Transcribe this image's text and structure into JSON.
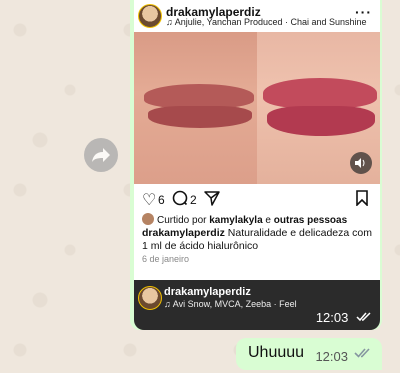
{
  "post": {
    "username": "drakamylaperdiz",
    "music": "Anjulie, Yanchan Produced · Chai and Sunshine",
    "likes": "6",
    "comments": "2",
    "liked_prefix": "Curtido por",
    "liked_user": "kamylakyla",
    "liked_and": "e",
    "liked_others": "outras pessoas",
    "caption_user": "drakamylaperdiz",
    "caption_text": "Naturalidade e delicadeza com 1 ml de ácido hialurônico",
    "date": "6 de janeiro"
  },
  "reel": {
    "username": "drakamylaperdiz",
    "music": "Avi Snow, MVCA, Zeeba · Feel",
    "time": "12:03"
  },
  "message": {
    "text": "Uhuuuu",
    "time": "12:03"
  },
  "colors": {
    "chat_bg": "#efe7dd",
    "outgoing_bubble": "#d9fdd3",
    "read_ticks": "#53bdeb"
  },
  "icons": [
    "forward-icon",
    "music-note-icon",
    "more-icon",
    "volume-icon",
    "heart-icon",
    "comment-icon",
    "share-icon",
    "bookmark-icon",
    "double-check-icon"
  ]
}
